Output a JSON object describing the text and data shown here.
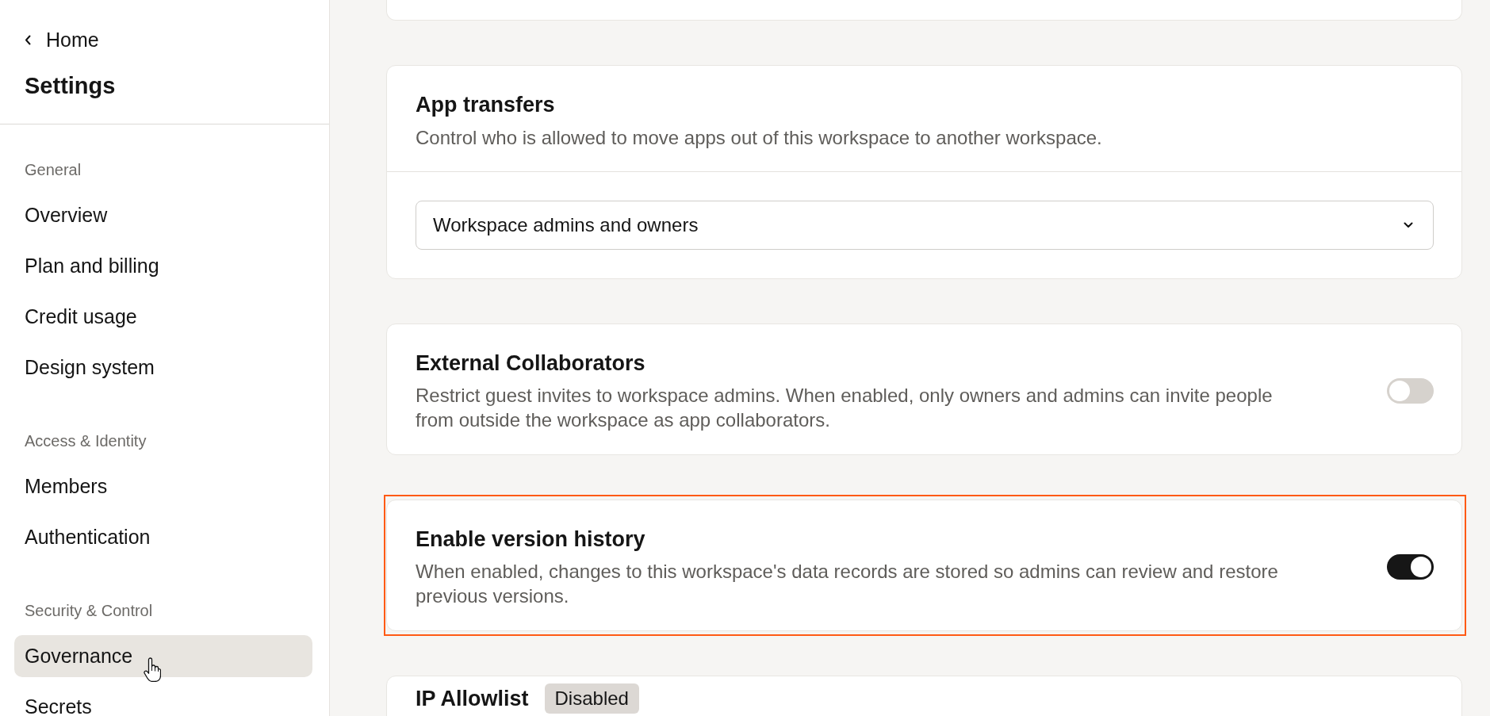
{
  "sidebar": {
    "back_link": {
      "label": "Home"
    },
    "title": "Settings",
    "groups": [
      {
        "label": "General",
        "items": [
          {
            "label": "Overview",
            "selected": false
          },
          {
            "label": "Plan and billing",
            "selected": false
          },
          {
            "label": "Credit usage",
            "selected": false
          },
          {
            "label": "Design system",
            "selected": false
          }
        ]
      },
      {
        "label": "Access & Identity",
        "items": [
          {
            "label": "Members",
            "selected": false
          },
          {
            "label": "Authentication",
            "selected": false
          }
        ]
      },
      {
        "label": "Security & Control",
        "items": [
          {
            "label": "Governance",
            "selected": true
          },
          {
            "label": "Secrets",
            "selected": false
          }
        ]
      }
    ]
  },
  "main": {
    "cards": [
      {
        "kind": "blank",
        "highlighted": false
      },
      {
        "kind": "select",
        "title": "App transfers",
        "description": "Control who is allowed to move apps out of this workspace to another workspace.",
        "select": {
          "value": "Workspace admins and owners"
        },
        "highlighted": false
      },
      {
        "kind": "toggle",
        "title": "External Collaborators",
        "description": "Restrict guest invites to workspace admins. When enabled, only owners and admins can invite people from outside the workspace as app collaborators.",
        "on": false,
        "highlighted": false
      },
      {
        "kind": "toggle",
        "title": "Enable version history",
        "description": "When enabled, changes to this workspace's data records are stored so admins can review and restore previous versions.",
        "on": true,
        "highlighted": true
      },
      {
        "kind": "badge",
        "title": "IP Allowlist",
        "badge": "Disabled",
        "highlighted": false
      }
    ]
  }
}
